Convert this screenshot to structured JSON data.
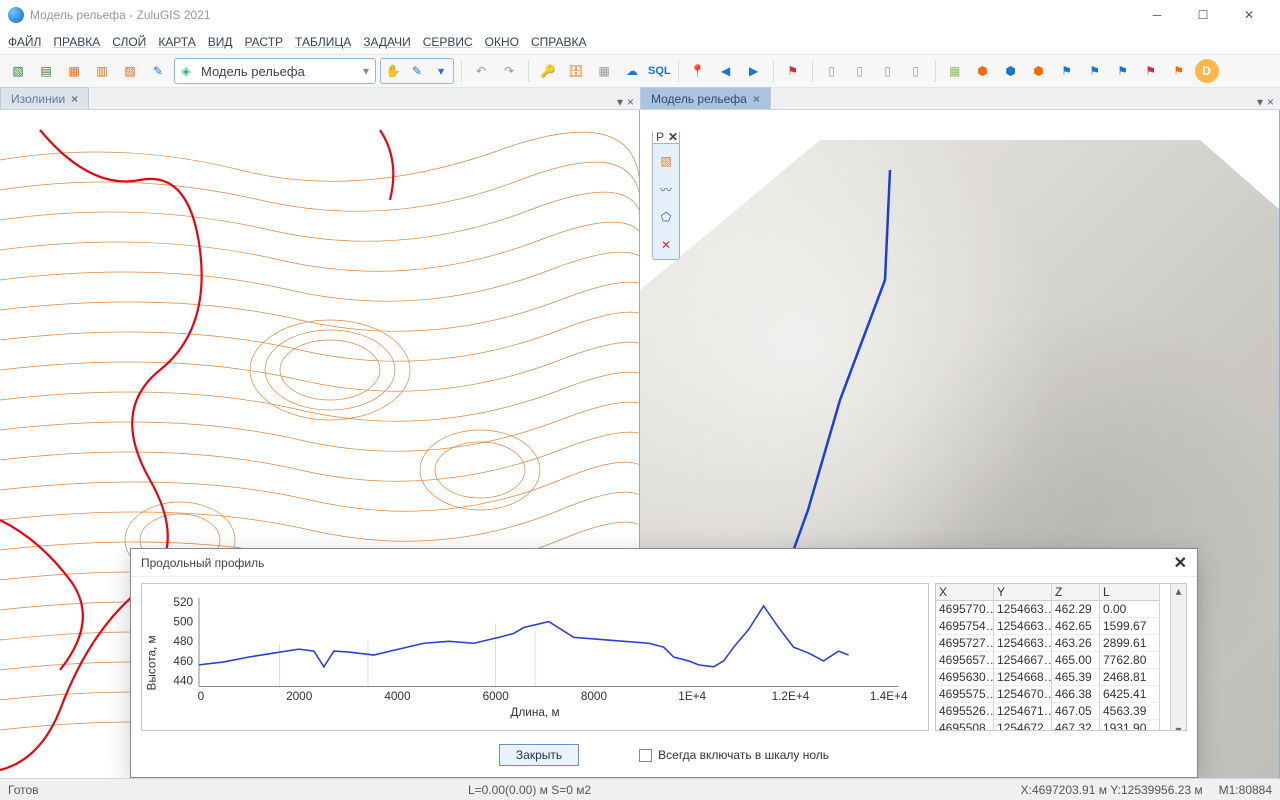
{
  "window": {
    "title": "Модель рельефа - ZuluGIS 2021"
  },
  "menu": [
    "ФАЙЛ",
    "ПРАВКА",
    "СЛОЙ",
    "КАРТА",
    "ВИД",
    "РАСТР",
    "ТАБЛИЦА",
    "ЗАДАЧИ",
    "СЕРВИС",
    "ОКНО",
    "СПРАВКА"
  ],
  "layer_selector": {
    "value": "Модель рельефа"
  },
  "tabs": {
    "left": {
      "label": "Изолинии"
    },
    "right": {
      "label": "Модель рельефа"
    }
  },
  "toolbox_label": "P",
  "dialog": {
    "title": "Продольный профиль",
    "close_btn": "Закрыть",
    "checkbox": "Всегда включать в шкалу ноль",
    "x_label": "Длина, м",
    "y_label": "Высота, м",
    "cols": {
      "x": "X",
      "y": "Y",
      "z": "Z",
      "l": "L"
    },
    "rows": [
      {
        "x": "4695770…",
        "y": "1254663…",
        "z": "462.29",
        "l": "0.00"
      },
      {
        "x": "4695754…",
        "y": "1254663…",
        "z": "462.65",
        "l": "1599.67"
      },
      {
        "x": "4695727…",
        "y": "1254663…",
        "z": "463.26",
        "l": "2899.61"
      },
      {
        "x": "4695657…",
        "y": "1254667…",
        "z": "465.00",
        "l": "7762.80"
      },
      {
        "x": "4695630…",
        "y": "1254668…",
        "z": "465.39",
        "l": "2468.81"
      },
      {
        "x": "4695575…",
        "y": "1254670…",
        "z": "466.38",
        "l": "6425.41"
      },
      {
        "x": "4695526…",
        "y": "1254671…",
        "z": "467.05",
        "l": "4563.39"
      },
      {
        "x": "4695508…",
        "y": "1254672…",
        "z": "467.32",
        "l": "1931.90"
      }
    ]
  },
  "status": {
    "ready": "Готов",
    "ls": "L=0.00(0.00) м S=0 м2",
    "coord": "X:4697203.91 м Y:12539956.23 м",
    "scale": "M1:80884"
  },
  "chart_data": {
    "type": "line",
    "xlabel": "Длина, м",
    "ylabel": "Высота, м",
    "xlim": [
      0,
      14000
    ],
    "ylim": [
      440,
      530
    ],
    "xticks": [
      0,
      2000,
      4000,
      6000,
      8000,
      "1E+4",
      "1.2E+4",
      "1.4E+4"
    ],
    "yticks": [
      440,
      460,
      480,
      500,
      520
    ],
    "x": [
      0,
      500,
      1000,
      1500,
      2000,
      2300,
      2500,
      2700,
      3000,
      3500,
      4000,
      4500,
      5000,
      5500,
      6000,
      6300,
      6500,
      7000,
      7500,
      8000,
      8500,
      9000,
      9300,
      9500,
      9800,
      10000,
      10300,
      10500,
      10700,
      11000,
      11300,
      11600,
      11900,
      12200,
      12500,
      12800,
      13000
    ],
    "values": [
      462,
      465,
      470,
      474,
      478,
      476,
      460,
      476,
      475,
      472,
      478,
      484,
      486,
      484,
      490,
      494,
      500,
      506,
      490,
      488,
      486,
      484,
      480,
      470,
      466,
      462,
      460,
      466,
      480,
      498,
      522,
      500,
      480,
      474,
      466,
      476,
      472
    ]
  }
}
